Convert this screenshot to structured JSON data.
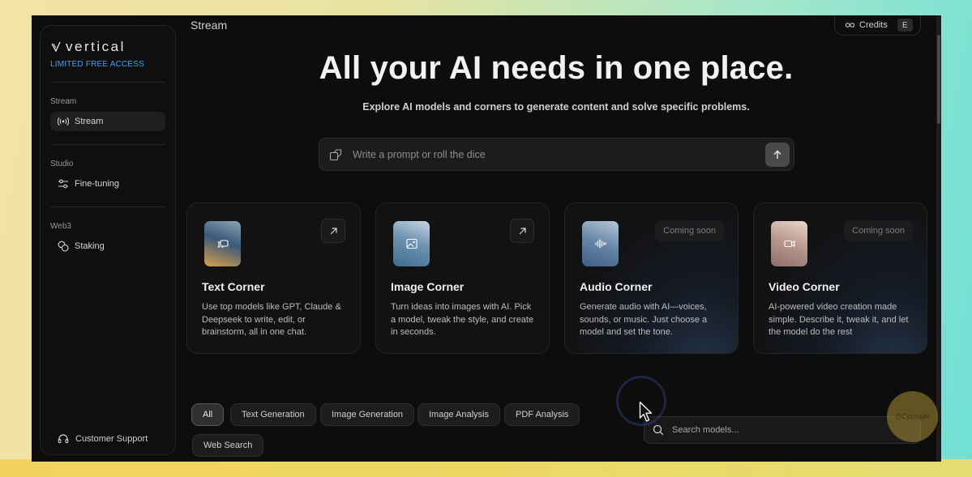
{
  "app": {
    "brand": "vertical",
    "access_label": "LIMITED FREE ACCESS"
  },
  "sidebar": {
    "sections": [
      {
        "label": "Stream",
        "item": {
          "label": "Stream",
          "icon": "broadcast-icon"
        }
      },
      {
        "label": "Studio",
        "item": {
          "label": "Fine-tuning",
          "icon": "sliders-icon"
        }
      },
      {
        "label": "Web3",
        "item": {
          "label": "Staking",
          "icon": "coins-icon"
        }
      }
    ],
    "support_label": "Customer Support"
  },
  "header": {
    "page_label": "Stream",
    "credits_label": "Credits",
    "avatar_initial": "E"
  },
  "hero": {
    "title": "All your AI needs in one place.",
    "subtitle": "Explore AI models and corners to generate content and solve specific problems."
  },
  "prompt": {
    "placeholder": "Write a prompt or roll the dice"
  },
  "cards": [
    {
      "title": "Text Corner",
      "description": "Use top models like GPT, Claude & Deepseek to write, edit, or brainstorm, all in one chat.",
      "icon": "chat-icon"
    },
    {
      "title": "Image Corner",
      "description": "Turn ideas into images with AI. Pick a model, tweak the style, and create in seconds.",
      "icon": "image-icon"
    },
    {
      "title": "Audio Corner",
      "description": "Generate audio with AI—voices, sounds, or music. Just choose a model and set the tone.",
      "icon": "waveform-icon",
      "badge": "Coming soon"
    },
    {
      "title": "Video Corner",
      "description": "AI-powered video creation made simple. Describe it, tweak it, and let the model do the rest",
      "icon": "video-icon",
      "badge": "Coming soon"
    }
  ],
  "filters": [
    "All",
    "Text Generation",
    "Image Generation",
    "Image Analysis",
    "PDF Analysis",
    "Web Search"
  ],
  "active_filter": "All",
  "search": {
    "placeholder": "Search models..."
  },
  "watermark_text": "@CyclopAI"
}
